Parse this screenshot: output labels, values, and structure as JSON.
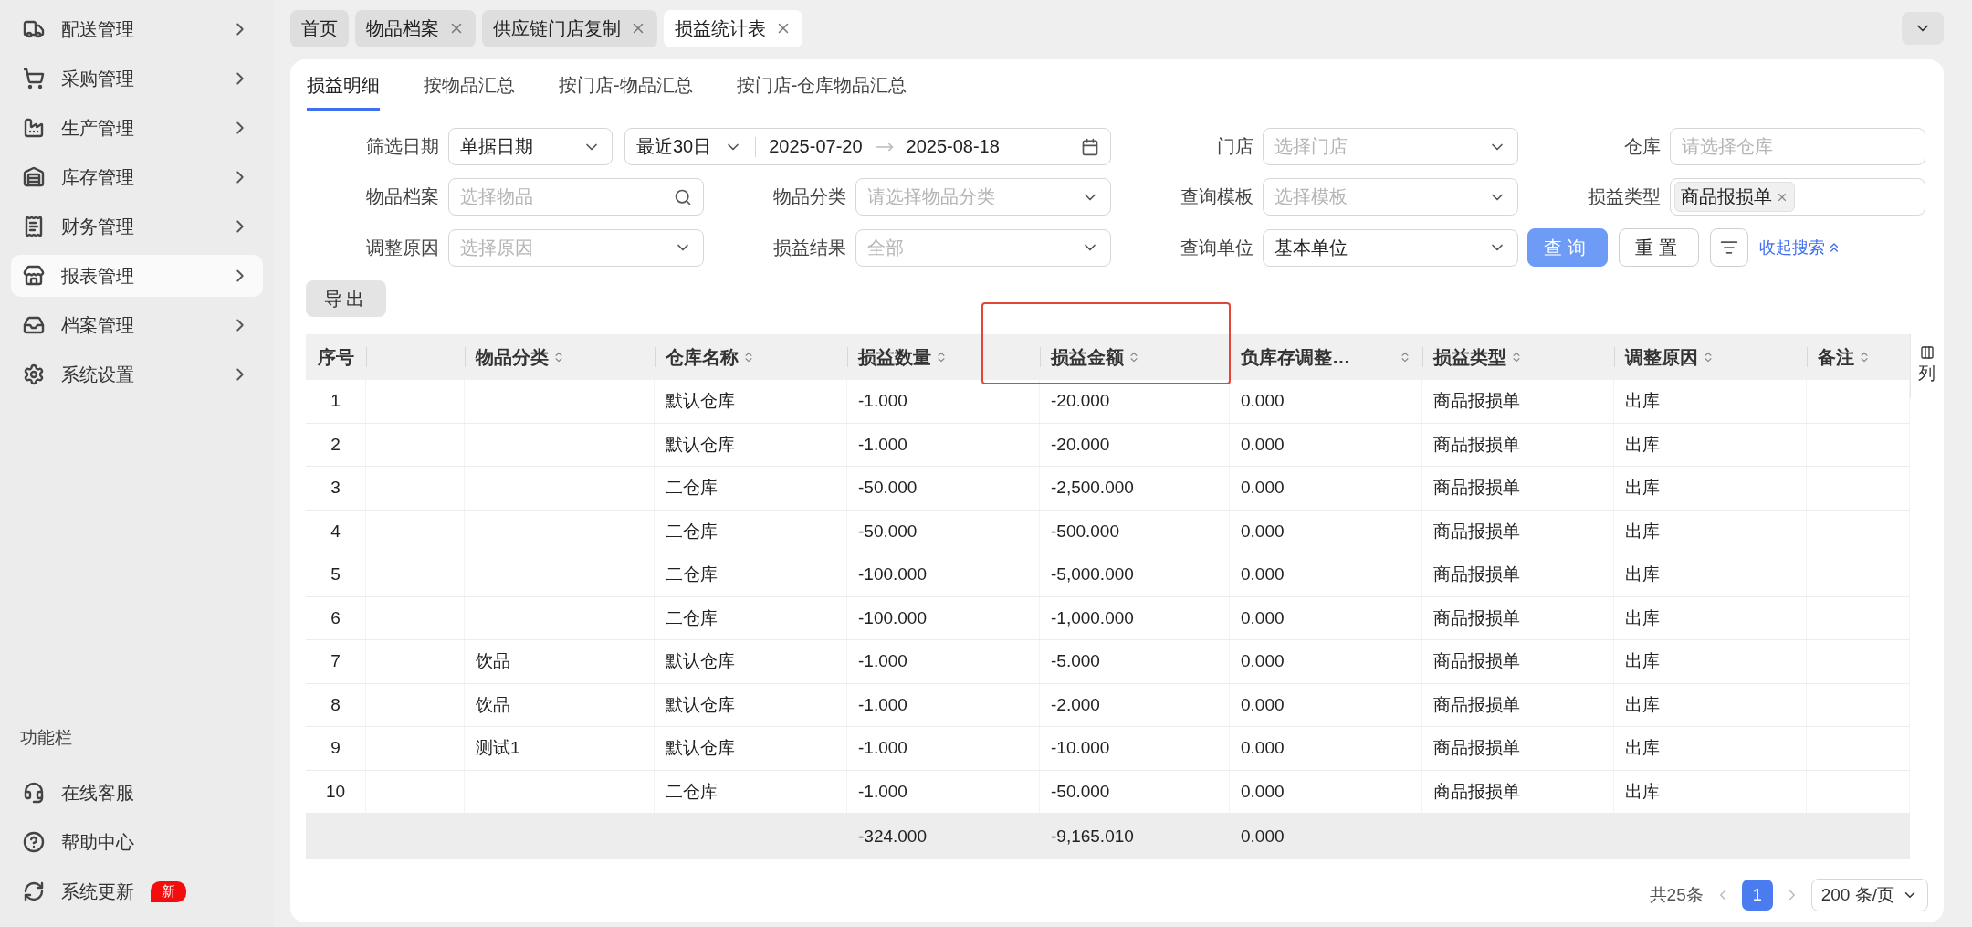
{
  "sidebar": {
    "items": [
      {
        "label": "配送管理",
        "selected": false
      },
      {
        "label": "采购管理",
        "selected": false
      },
      {
        "label": "生产管理",
        "selected": false
      },
      {
        "label": "库存管理",
        "selected": false
      },
      {
        "label": "财务管理",
        "selected": false
      },
      {
        "label": "报表管理",
        "selected": true
      },
      {
        "label": "档案管理",
        "selected": false
      },
      {
        "label": "系统设置",
        "selected": false
      }
    ],
    "tools_title": "功能栏",
    "tools": [
      {
        "label": "在线客服"
      },
      {
        "label": "帮助中心"
      },
      {
        "label": "系统更新",
        "badge": "新"
      }
    ]
  },
  "page_tabs": [
    {
      "label": "首页",
      "closable": false,
      "selected": false
    },
    {
      "label": "物品档案",
      "closable": true,
      "selected": false
    },
    {
      "label": "供应链门店复制",
      "closable": true,
      "selected": false
    },
    {
      "label": "损益统计表",
      "closable": true,
      "selected": true
    }
  ],
  "report_tabs": [
    {
      "label": "损益明细",
      "selected": true
    },
    {
      "label": "按物品汇总",
      "selected": false
    },
    {
      "label": "按门店-物品汇总",
      "selected": false
    },
    {
      "label": "按门店-仓库物品汇总",
      "selected": false
    }
  ],
  "filters": [
    {
      "label": "筛选日期",
      "kind": "date",
      "value": "单据日期",
      "preset": "最近30日",
      "start": "2025-07-20",
      "end": "2025-08-18"
    },
    {
      "label": "门店",
      "kind": "select",
      "placeholder": "选择门店"
    },
    {
      "label": "仓库",
      "kind": "input",
      "placeholder": "请选择仓库"
    },
    {
      "label": "物品档案",
      "kind": "search",
      "placeholder": "选择物品"
    },
    {
      "label": "物品分类",
      "kind": "select",
      "placeholder": "请选择物品分类"
    },
    {
      "label": "查询模板",
      "kind": "select",
      "placeholder": "选择模板"
    },
    {
      "label": "损益类型",
      "kind": "tags",
      "tags": [
        "商品报损单"
      ]
    },
    {
      "label": "调整原因",
      "kind": "select",
      "placeholder": "选择原因"
    },
    {
      "label": "损益结果",
      "kind": "select",
      "placeholder": "全部"
    },
    {
      "label": "查询单位",
      "kind": "select",
      "value": "基本单位"
    }
  ],
  "actions": {
    "buttons": [
      {
        "label": "查询",
        "kind": "primary"
      },
      {
        "label": "重置",
        "kind": "default"
      }
    ],
    "collapse_link": "收起搜索"
  },
  "export_button": "导出",
  "table": {
    "columns": [
      {
        "label": "序号",
        "sortable": false
      },
      {
        "label": "物品分类",
        "sortable": true
      },
      {
        "label": "仓库名称",
        "sortable": true
      },
      {
        "label": "损益数量",
        "sortable": true
      },
      {
        "label": "损益金额",
        "sortable": true
      },
      {
        "label": "负库存调整…",
        "sortable": true
      },
      {
        "label": "损益类型",
        "sortable": true
      },
      {
        "label": "调整原因",
        "sortable": true
      },
      {
        "label": "备注",
        "sortable": true
      }
    ],
    "rows": [
      {
        "no": "1",
        "warehouse": "默认仓库",
        "qty": "-1.000",
        "amount": "-20.000",
        "neg_adj": "0.000",
        "type": "商品报损单",
        "reason": "出库"
      },
      {
        "no": "2",
        "warehouse": "默认仓库",
        "qty": "-1.000",
        "amount": "-20.000",
        "neg_adj": "0.000",
        "type": "商品报损单",
        "reason": "出库"
      },
      {
        "no": "3",
        "warehouse": "二仓库",
        "qty": "-50.000",
        "amount": "-2,500.000",
        "neg_adj": "0.000",
        "type": "商品报损单",
        "reason": "出库"
      },
      {
        "no": "4",
        "warehouse": "二仓库",
        "qty": "-50.000",
        "amount": "-500.000",
        "neg_adj": "0.000",
        "type": "商品报损单",
        "reason": "出库"
      },
      {
        "no": "5",
        "warehouse": "二仓库",
        "qty": "-100.000",
        "amount": "-5,000.000",
        "neg_adj": "0.000",
        "type": "商品报损单",
        "reason": "出库"
      },
      {
        "no": "6",
        "warehouse": "二仓库",
        "qty": "-100.000",
        "amount": "-1,000.000",
        "neg_adj": "0.000",
        "type": "商品报损单",
        "reason": "出库"
      },
      {
        "no": "7",
        "category": "饮品",
        "warehouse": "默认仓库",
        "qty": "-1.000",
        "amount": "-5.000",
        "neg_adj": "0.000",
        "type": "商品报损单",
        "reason": "出库"
      },
      {
        "no": "8",
        "category": "饮品",
        "warehouse": "默认仓库",
        "qty": "-1.000",
        "amount": "-2.000",
        "neg_adj": "0.000",
        "type": "商品报损单",
        "reason": "出库"
      },
      {
        "no": "9",
        "category": "测试1",
        "warehouse": "默认仓库",
        "qty": "-1.000",
        "amount": "-10.000",
        "neg_adj": "0.000",
        "type": "商品报损单",
        "reason": "出库"
      },
      {
        "no": "10",
        "warehouse": "二仓库",
        "qty": "-1.000",
        "amount": "-50.000",
        "neg_adj": "0.000",
        "type": "商品报损单",
        "reason": "出库"
      }
    ],
    "summary": {
      "qty": "-324.000",
      "amount": "-9,165.010",
      "neg_adj": "0.000"
    },
    "column_settings": "列"
  },
  "pagination": {
    "total": "共25条",
    "pages": [
      {
        "label": "1",
        "selected": true
      }
    ],
    "page_size": "200 条/页"
  }
}
